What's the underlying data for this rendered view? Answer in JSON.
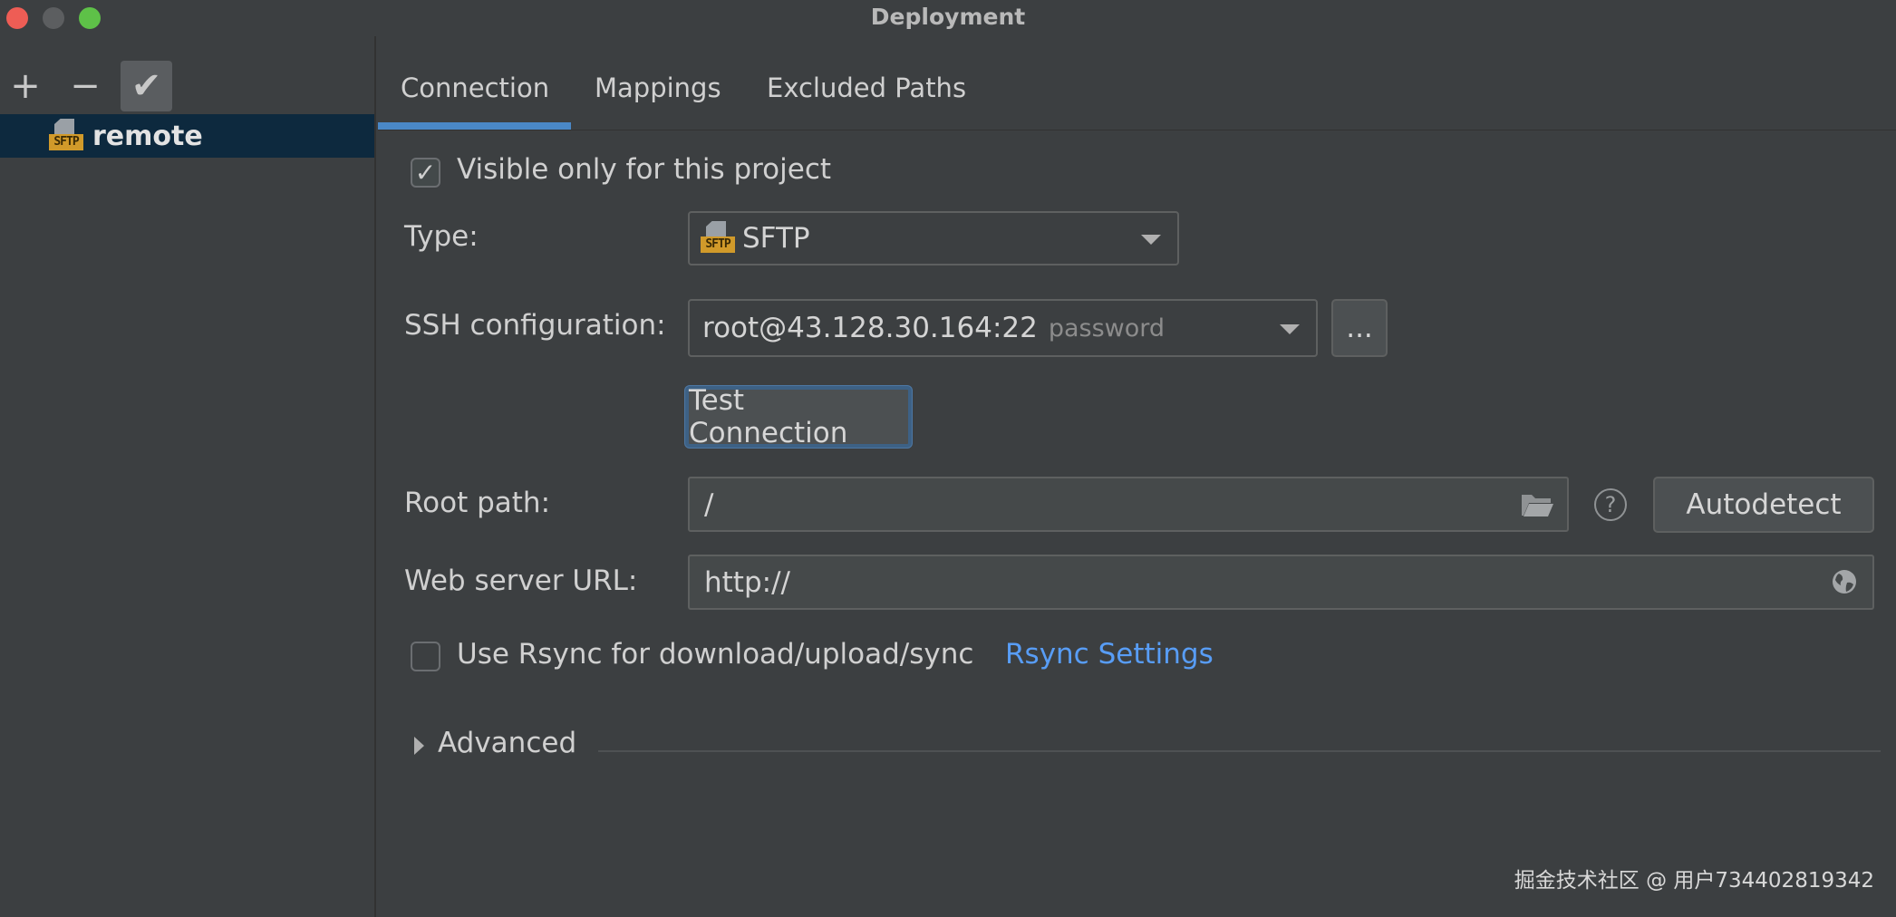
{
  "window": {
    "title": "Deployment"
  },
  "left": {
    "toolbar": {
      "add": "+",
      "remove": "−",
      "set_default": "✔"
    },
    "servers": [
      {
        "name": "remote",
        "icon": "sftp-server-icon",
        "icon_tag": "SFTP",
        "selected": true
      }
    ]
  },
  "tabs": [
    {
      "label": "Connection",
      "active": true
    },
    {
      "label": "Mappings",
      "active": false
    },
    {
      "label": "Excluded Paths",
      "active": false
    }
  ],
  "connection": {
    "visible_only": {
      "label": "Visible only for this project",
      "checked": true
    },
    "type": {
      "label": "Type:",
      "value": "SFTP",
      "icon_tag": "SFTP"
    },
    "ssh": {
      "label": "SSH configuration:",
      "value": "root@43.128.30.164:22",
      "hint": "password",
      "browse": "..."
    },
    "test_connection": "Test Connection",
    "root_path": {
      "label": "Root path:",
      "value": "/",
      "help": "?",
      "autodetect": "Autodetect"
    },
    "web_url": {
      "label": "Web server URL:",
      "value": "http://"
    },
    "rsync": {
      "label": "Use Rsync for download/upload/sync",
      "checked": false,
      "link": "Rsync Settings"
    },
    "advanced": "Advanced"
  },
  "watermark": "掘金技术社区 @ 用户734402819342",
  "colors": {
    "accent": "#4a88c7",
    "link": "#589df6",
    "selection": "#0d293e",
    "background": "#3c3f41"
  }
}
